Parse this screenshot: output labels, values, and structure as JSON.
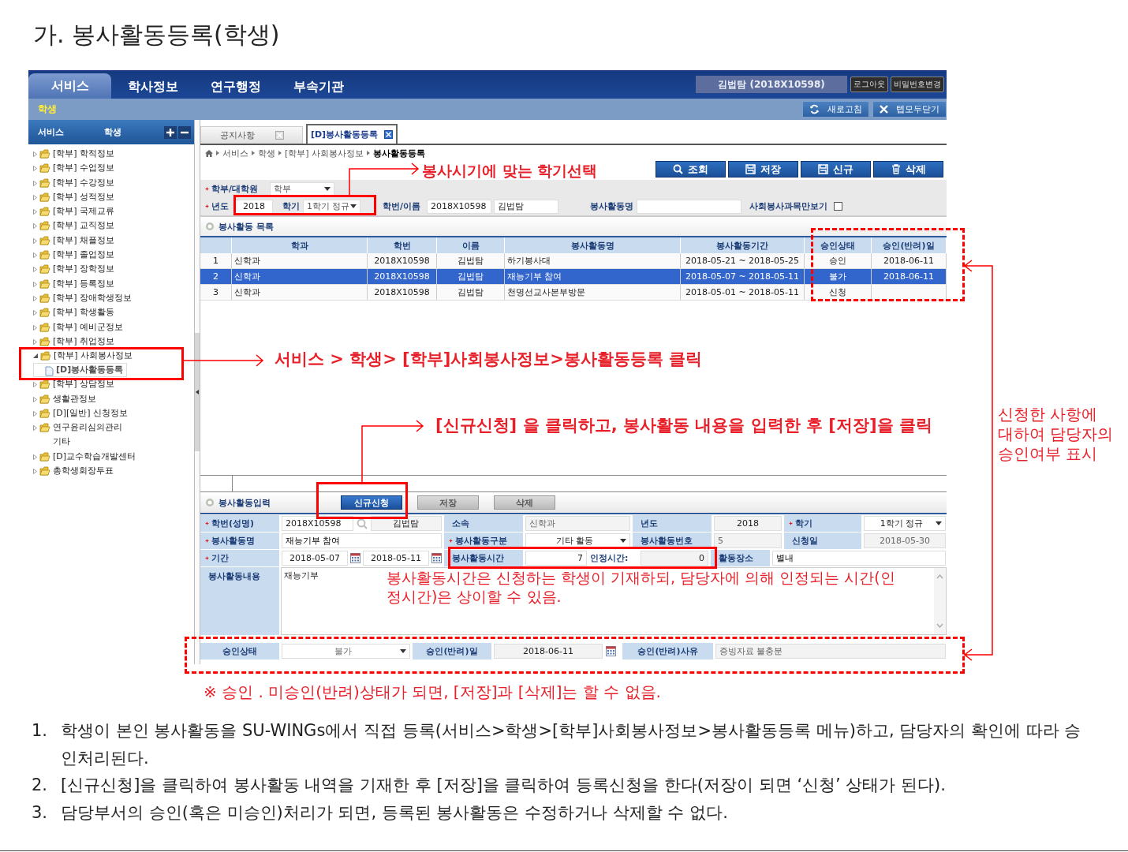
{
  "page_title": "가. 봉사활동등록(학생)",
  "app": {
    "top_menu": [
      {
        "label": "서비스",
        "selected": true
      },
      {
        "label": "학사정보",
        "selected": false
      },
      {
        "label": "연구행정",
        "selected": false
      },
      {
        "label": "부속기관",
        "selected": false
      }
    ],
    "user": "김법탐 (2018X10598)",
    "user_buttons": [
      "로그아웃",
      "비밀번호변경"
    ],
    "sub_menu": "학생",
    "tool_buttons": [
      {
        "label": "새로고침",
        "kind": "refresh"
      },
      {
        "label": "텝모두닫기",
        "kind": "close"
      }
    ],
    "sidebar": {
      "path": [
        "서비스",
        "학생"
      ],
      "items": [
        {
          "label": "[학부] 학적정보",
          "kind": "folder",
          "expanded": false,
          "selected": false
        },
        {
          "label": "[학부] 수업정보",
          "kind": "folder",
          "expanded": false,
          "selected": false
        },
        {
          "label": "[학부] 수강정보",
          "kind": "folder",
          "expanded": false,
          "selected": false
        },
        {
          "label": "[학부] 성적정보",
          "kind": "folder",
          "expanded": false,
          "selected": false
        },
        {
          "label": "[학부] 국제교류",
          "kind": "folder",
          "expanded": false,
          "selected": false
        },
        {
          "label": "[학부] 교직정보",
          "kind": "folder",
          "expanded": false,
          "selected": false
        },
        {
          "label": "[학부] 채플정보",
          "kind": "folder",
          "expanded": false,
          "selected": false
        },
        {
          "label": "[학부] 졸업정보",
          "kind": "folder",
          "expanded": false,
          "selected": false
        },
        {
          "label": "[학부] 장학정보",
          "kind": "folder",
          "expanded": false,
          "selected": false
        },
        {
          "label": "[학부] 등록정보",
          "kind": "folder",
          "expanded": false,
          "selected": false
        },
        {
          "label": "[학부] 장애학생정보",
          "kind": "folder",
          "expanded": false,
          "selected": false
        },
        {
          "label": "[학부] 학생활동",
          "kind": "folder",
          "expanded": false,
          "selected": false
        },
        {
          "label": "[학부] 예비군정보",
          "kind": "folder",
          "expanded": false,
          "selected": false
        },
        {
          "label": "[학부] 취업정보",
          "kind": "folder",
          "expanded": false,
          "selected": false
        },
        {
          "label": "[학부] 사회봉사정보",
          "kind": "folder",
          "expanded": true,
          "selected": false,
          "children": [
            {
              "label": "[D]봉사활동등록",
              "kind": "page",
              "selected": true
            }
          ]
        },
        {
          "label": "[학부] 상담정보",
          "kind": "folder",
          "expanded": false,
          "selected": false
        },
        {
          "label": "생활관정보",
          "kind": "folder",
          "expanded": false,
          "selected": false
        },
        {
          "label": "[D][일반] 신청정보",
          "kind": "folder",
          "expanded": false,
          "selected": false
        },
        {
          "label": "연구윤리심의관리\n기타",
          "kind": "folder",
          "expanded": false,
          "selected": false
        },
        {
          "label": "[D]교수학습개발센터",
          "kind": "folder",
          "expanded": false,
          "selected": false
        },
        {
          "label": "총학생회장투표",
          "kind": "folder",
          "expanded": false,
          "selected": false
        }
      ]
    },
    "tabs": [
      {
        "label": "공지사항",
        "selected": false
      },
      {
        "label": "[D]봉사활동등록",
        "selected": true
      }
    ],
    "breadcrumb": [
      "서비스",
      "학생",
      "[학부] 사회봉사정보",
      "봉사활동등록"
    ],
    "actions": [
      {
        "label": "조회",
        "kind": "search"
      },
      {
        "label": "저장",
        "kind": "save"
      },
      {
        "label": "신규",
        "kind": "new"
      },
      {
        "label": "삭제",
        "kind": "delete"
      }
    ],
    "search": {
      "level": {
        "label": "학부/대학원",
        "required": true,
        "value": "학부"
      },
      "year": {
        "label": "년도",
        "required": true,
        "value": "2018"
      },
      "term": {
        "label": "학기",
        "value": "1학기 정규"
      },
      "student": {
        "label": "학번/이름",
        "id": "2018X10598",
        "name": "김법탐"
      },
      "activity": {
        "label": "봉사활동명"
      },
      "social_only": {
        "label": "사회봉사과목만보기",
        "checked": false
      }
    },
    "list": {
      "title": "봉사활동 목록",
      "columns": [
        "학과",
        "학번",
        "이름",
        "봉사활동명",
        "봉사활동기간",
        "승인상태",
        "승인(반려)일"
      ],
      "rows": [
        {
          "no": "1",
          "selected": false,
          "cells": [
            "신학과",
            "2018X10598",
            "김법탐",
            "하기봉사대",
            "2018-05-21 ~ 2018-05-25",
            "승인",
            "2018-06-11"
          ]
        },
        {
          "no": "2",
          "selected": true,
          "cells": [
            "신학과",
            "2018X10598",
            "김법탐",
            "재능기부 참여",
            "2018-05-07 ~ 2018-05-11",
            "불가",
            "2018-06-11"
          ]
        },
        {
          "no": "3",
          "selected": false,
          "cells": [
            "신학과",
            "2018X10598",
            "김법탐",
            "천명선교사본부방문",
            "2018-05-01 ~ 2018-05-11",
            "신청"
          ]
        }
      ]
    },
    "input": {
      "title": "봉사활동입력",
      "buttons": [
        {
          "label": "신규신청",
          "disabled": false
        },
        {
          "label": "저장",
          "disabled": true
        },
        {
          "label": "삭제",
          "disabled": true
        }
      ],
      "student": {
        "label": "학번(성명)",
        "required": true,
        "id": "2018X10598",
        "name": "김법탐"
      },
      "dept": {
        "label": "소속",
        "value": "신학과"
      },
      "year": {
        "label": "년도",
        "value": "2018"
      },
      "term": {
        "label": "학기",
        "required": true,
        "value": "1학기 정규"
      },
      "name": {
        "label": "봉사활동명",
        "required": true,
        "value": "재능기부 참여"
      },
      "category": {
        "label": "봉사활동구분",
        "required": true,
        "value": "기타 활동"
      },
      "number": {
        "label": "봉사활동번호",
        "value": "5"
      },
      "applied": {
        "label": "신청일",
        "value": "2018-05-30"
      },
      "period": {
        "label": "기간",
        "required": true,
        "from": "2018-05-07",
        "to": "2018-05-11"
      },
      "hours": {
        "label": "봉사활동시간",
        "value": "7"
      },
      "recognized": {
        "label": "인정시간:",
        "value": "0"
      },
      "place": {
        "label": "활동장소",
        "value": "별내"
      },
      "content": {
        "label": "봉사활동내용",
        "value": "재능기부"
      },
      "status": {
        "label": "승인상태",
        "value": "불가"
      },
      "decided": {
        "label": "승인(반려)일",
        "value": "2018-06-11"
      },
      "reason": {
        "label": "승인(반려)사유",
        "value": "증빙자료 불충분"
      }
    }
  },
  "annotations": {
    "term_hint": "봉사시기에 맞는 학기선택",
    "menu_hint": "서비스 > 학생> [학부]사회봉사정보>봉사활동등록 클릭",
    "new_hint": "[신규신청] 을 클릭하고, 봉사활동 내용을 입력한 후 [저장]을 클릭",
    "hours_hint": [
      "봉사활동시간은 신청하는 학생이 기재하되, 담당자에 의해 인정되는 시간(인",
      "정시간)은 상이할 수 있음."
    ],
    "approval_hint": [
      "신청한 사항에",
      "대하여 담당자의",
      "승인여부 표시"
    ],
    "note": "※ 승인 . 미승인(반려)상태가 되면, [저장]과 [삭제]는 할 수 없음."
  },
  "steps": [
    {
      "number": "1.",
      "text": "학생이 본인 봉사활동을 SU-WINGs에서 직접 등록(서비스>학생>[학부]사회봉사정보>봉사활동등록 메뉴)하고, 담당자의 확인에 따라 승인처리된다."
    },
    {
      "number": "2.",
      "text": "[신규신청]을 클릭하여 봉사활동 내역을 기재한 후 [저장]을 클릭하여 등록신청을 한다(저장이 되면 ‘신청’ 상태가 된다)."
    },
    {
      "number": "3.",
      "text": "담당부서의 승인(혹은 미승인)처리가 되면, 등록된 봉사활동은 수정하거나 삭제할 수 없다."
    }
  ]
}
